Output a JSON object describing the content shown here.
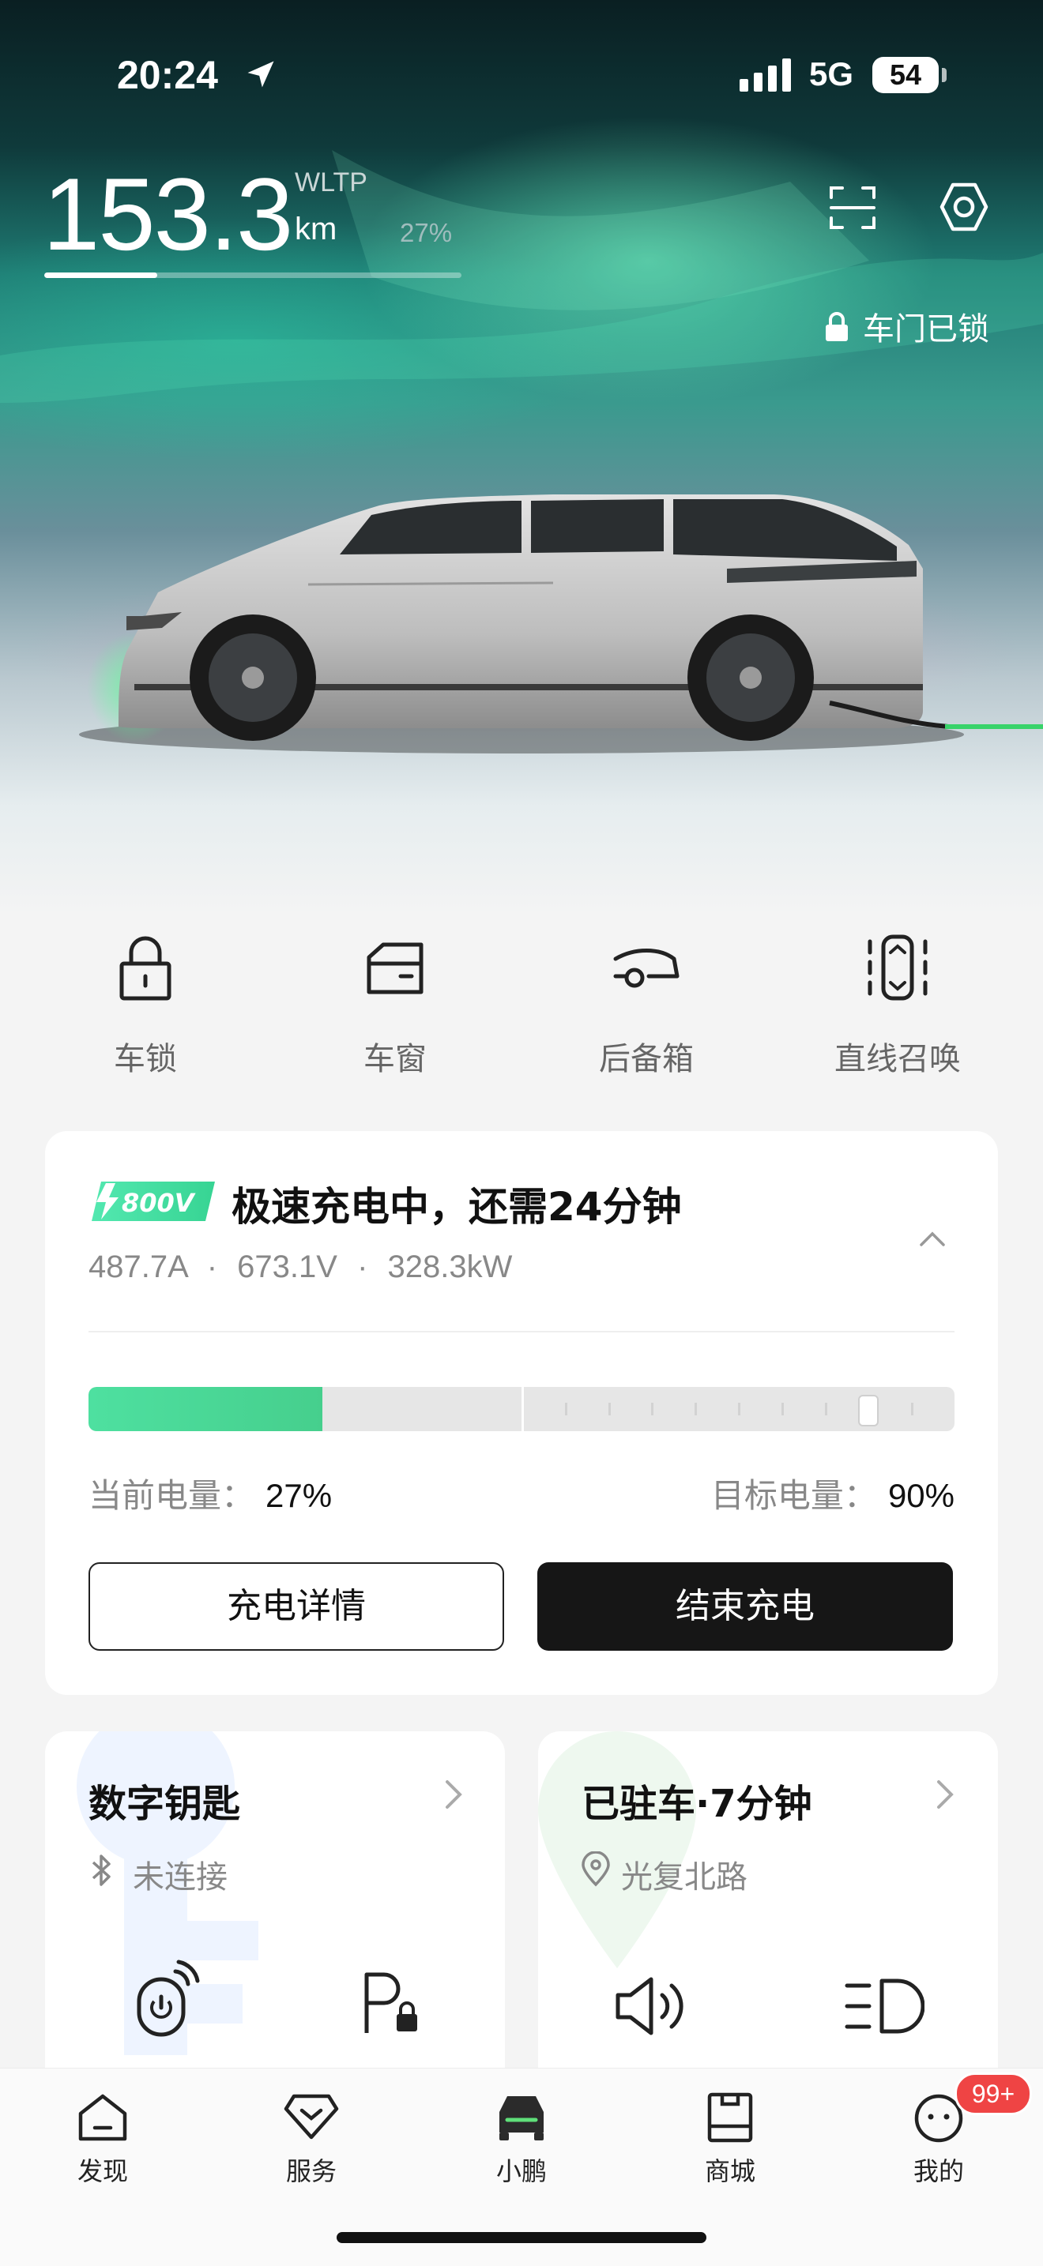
{
  "status_bar": {
    "time": "20:24",
    "network": "5G",
    "battery": "54"
  },
  "range": {
    "value": "153.3",
    "standard": "WLTP",
    "unit": "km",
    "percent_text": "27%",
    "fill": 0.27
  },
  "door_status": "车门已锁",
  "quick_actions": [
    {
      "label": "车锁",
      "icon": "padlock-icon"
    },
    {
      "label": "车窗",
      "icon": "car-window-icon"
    },
    {
      "label": "后备箱",
      "icon": "trunk-icon"
    },
    {
      "label": "直线召唤",
      "icon": "straight-summon-icon"
    }
  ],
  "charging": {
    "badge": "800V",
    "title": "极速充电中，还需24分钟",
    "current": "487.7A",
    "voltage": "673.1V",
    "power": "328.3kW",
    "current_level_label": "当前电量：",
    "current_level": "27%",
    "target_level_label": "目标电量：",
    "target_level": "90%",
    "current_fraction": 0.27,
    "target_fraction": 0.9,
    "details_button": "充电详情",
    "stop_button": "结束充电",
    "accent": "#46cf8d"
  },
  "digital_key": {
    "title": "数字钥匙",
    "status": "未连接"
  },
  "parking": {
    "title": "已驻车·7分钟",
    "location": "光复北路"
  },
  "tabs": [
    {
      "label": "发现"
    },
    {
      "label": "服务"
    },
    {
      "label": "小鹏"
    },
    {
      "label": "商城"
    },
    {
      "label": "我的",
      "badge": "99+"
    }
  ]
}
